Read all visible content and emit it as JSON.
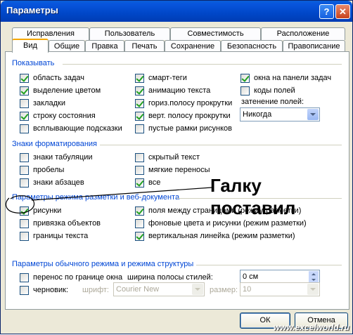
{
  "window": {
    "title": "Параметры",
    "help": "?",
    "close": "✕"
  },
  "tabs_back": [
    "Исправления",
    "Пользователь",
    "Совместимость",
    "Расположение"
  ],
  "tabs_front": [
    "Вид",
    "Общие",
    "Правка",
    "Печать",
    "Сохранение",
    "Безопасность",
    "Правописание"
  ],
  "active_tab": "Вид",
  "show": {
    "title": "Показывать",
    "col1": [
      {
        "label": "область задач",
        "checked": true
      },
      {
        "label": "выделение цветом",
        "checked": true
      },
      {
        "label": "закладки",
        "checked": false
      },
      {
        "label": "строку состояния",
        "checked": true
      },
      {
        "label": "всплывающие подсказки",
        "checked": false
      }
    ],
    "col2": [
      {
        "label": "смарт-теги",
        "checked": true
      },
      {
        "label": "анимацию текста",
        "checked": true
      },
      {
        "label": "гориз.полосу прокрутки",
        "checked": true
      },
      {
        "label": "верт. полосу прокрутки",
        "checked": true
      },
      {
        "label": "пустые рамки рисунков",
        "checked": false
      }
    ],
    "col3": [
      {
        "label": "окна на панели задач",
        "checked": true
      },
      {
        "label": "коды полей",
        "checked": false
      }
    ],
    "shading_label": "затенение полей:",
    "shading_value": "Никогда"
  },
  "format": {
    "title": "Знаки форматирования",
    "col1": [
      {
        "label": "знаки табуляции",
        "checked": false
      },
      {
        "label": "пробелы",
        "checked": false
      },
      {
        "label": "знаки абзацев",
        "checked": false
      }
    ],
    "col2": [
      {
        "label": "скрытый текст",
        "checked": false
      },
      {
        "label": "мягкие переносы",
        "checked": false
      },
      {
        "label": "все",
        "checked": true
      }
    ]
  },
  "layout": {
    "title": "Параметры режима разметки и веб-документа",
    "col1": [
      {
        "label": "рисунки",
        "checked": true
      },
      {
        "label": "привязка объектов",
        "checked": false
      },
      {
        "label": "границы текста",
        "checked": false
      }
    ],
    "col2": [
      {
        "label": "поля между страницами (режим разметки)",
        "checked": true
      },
      {
        "label": "фоновые цвета и рисунки (режим разметки)",
        "checked": false
      },
      {
        "label": "вертикальная линейка (режим разметки)",
        "checked": true
      }
    ]
  },
  "normal": {
    "title": "Параметры обычного режима и режима структуры",
    "wrap": {
      "label": "перенос по границе окна",
      "checked": false
    },
    "draft": {
      "label": "черновик:",
      "checked": false
    },
    "style_width_label": "ширина полосы стилей:",
    "style_width_value": "0 см",
    "font_label": "шрифт:",
    "font_value": "Courier New",
    "size_label": "размер:",
    "size_value": "10"
  },
  "buttons": {
    "ok": "ОК",
    "cancel": "Отмена"
  },
  "annotation": {
    "line1": "Галку",
    "line2": "поставил"
  },
  "watermark": "www.excelworld.ru"
}
